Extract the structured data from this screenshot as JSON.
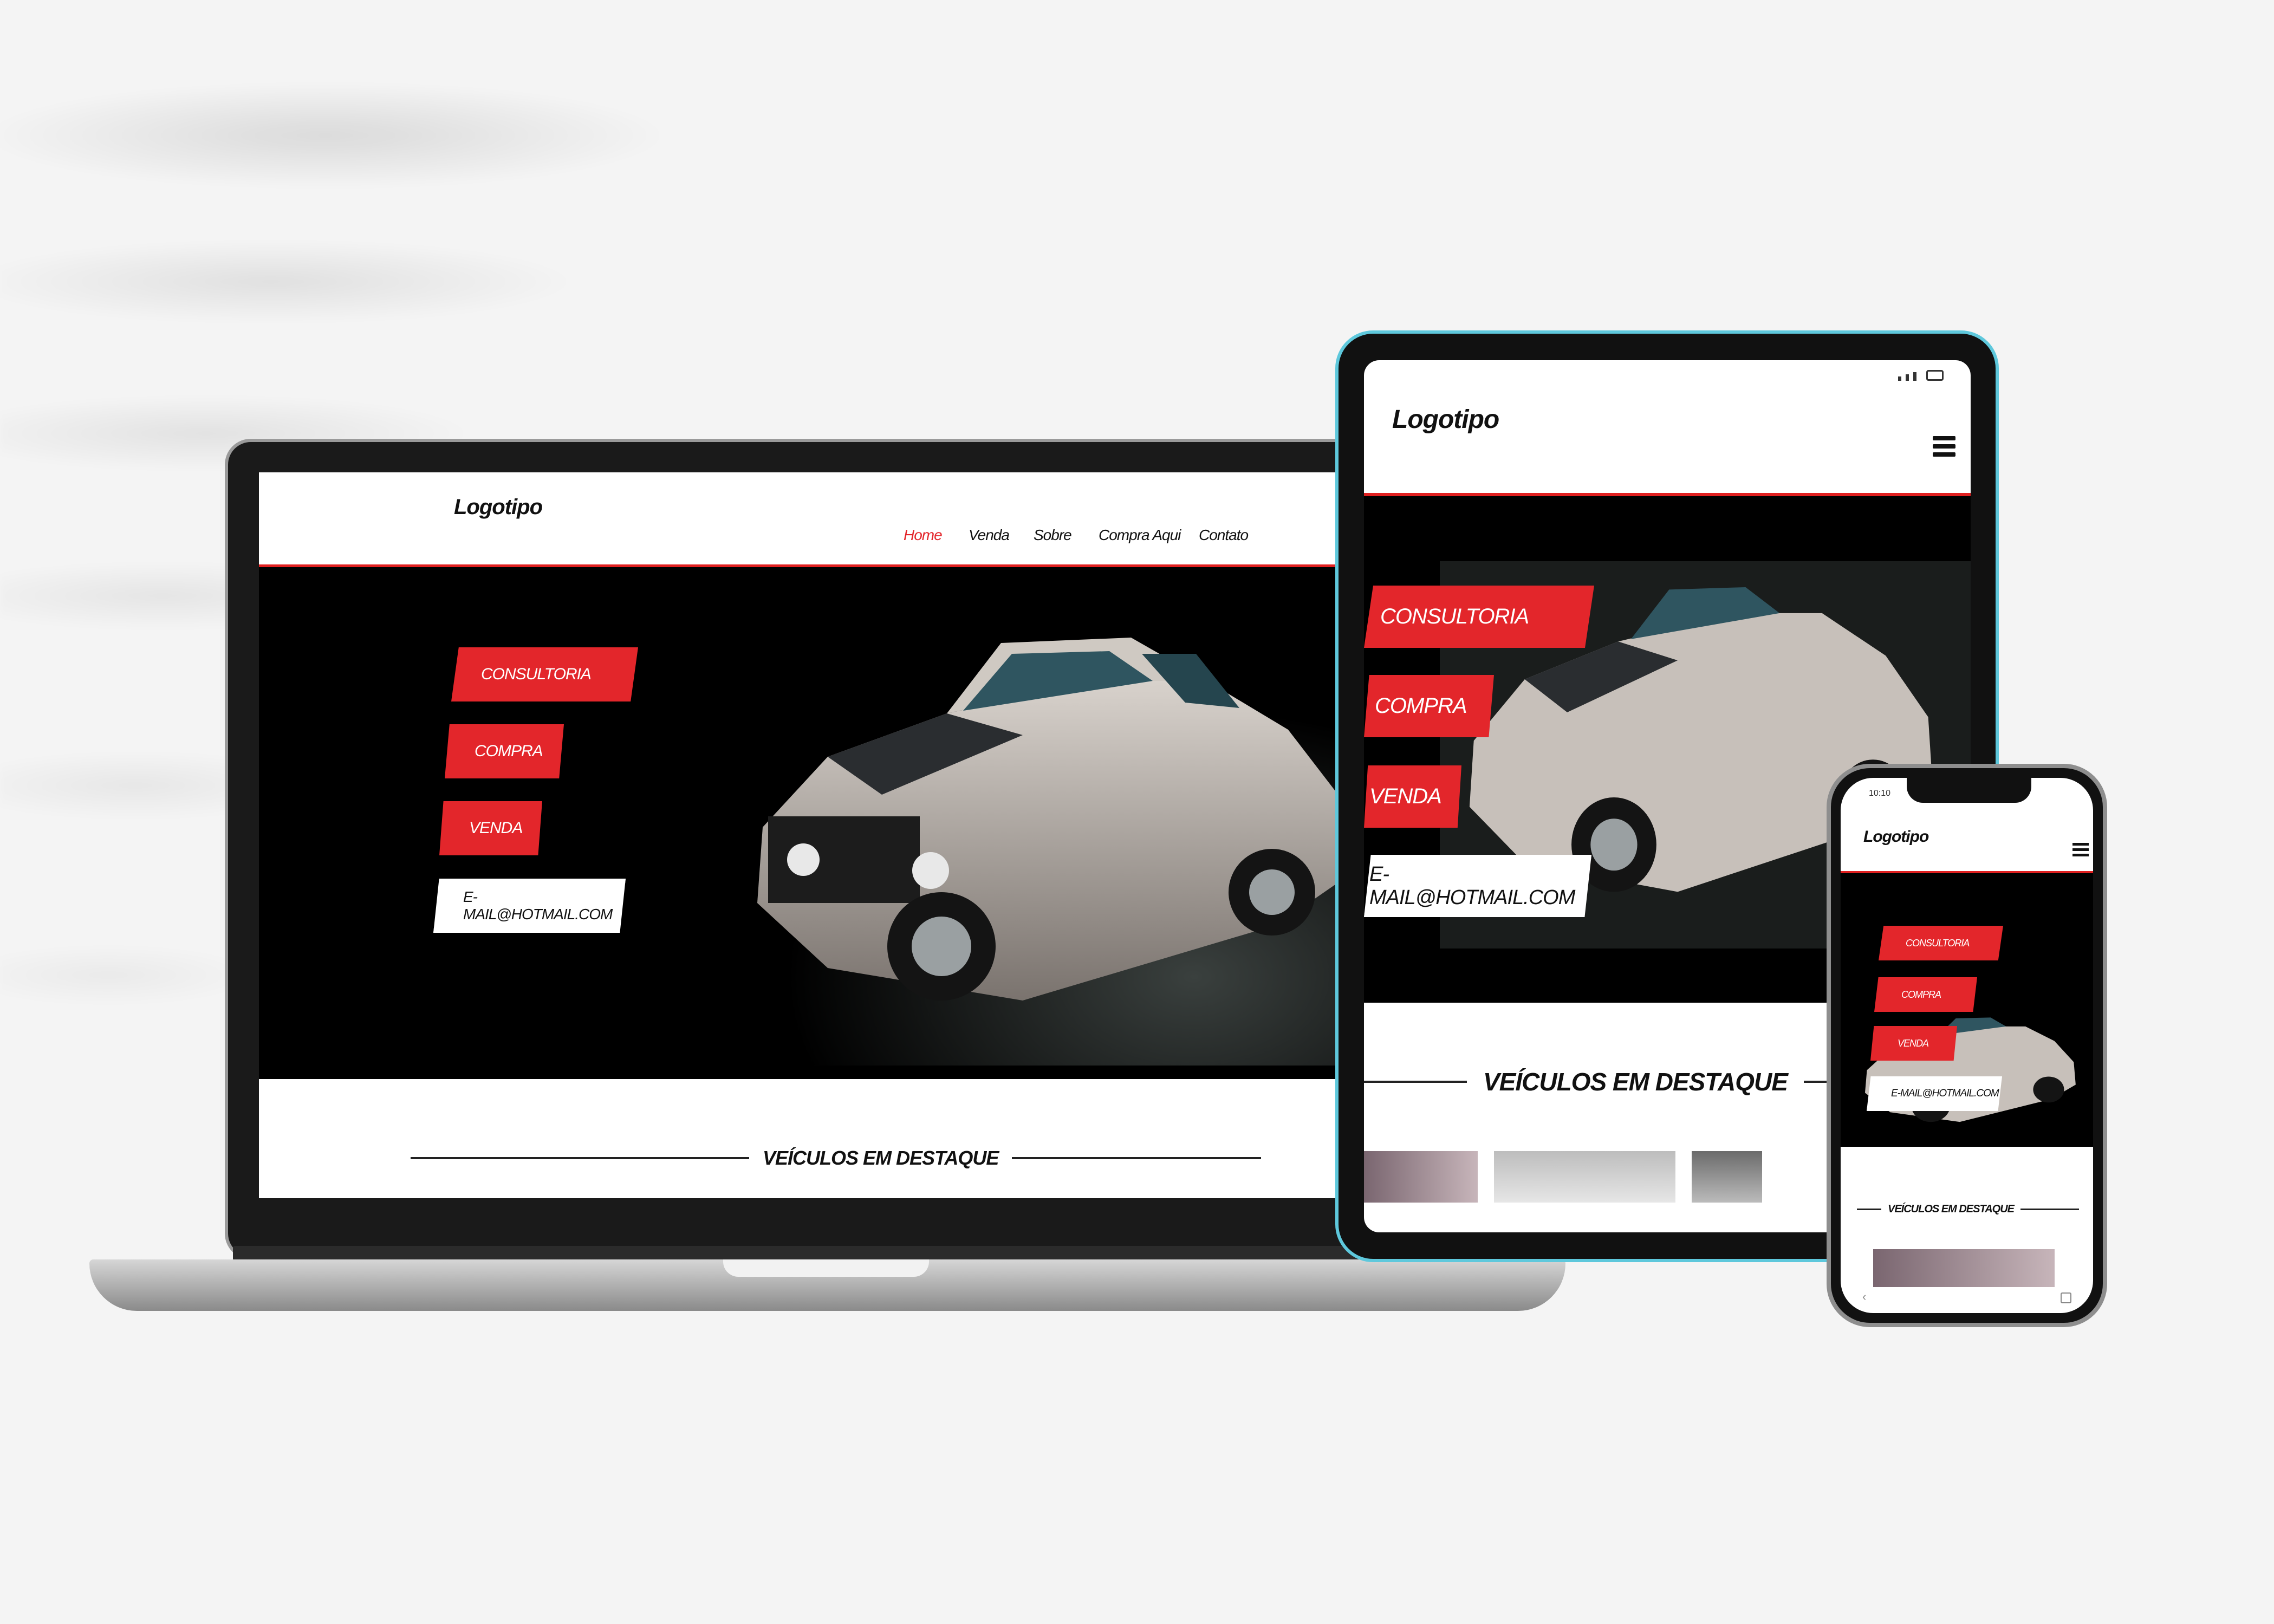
{
  "laptop": {
    "logo": "Logotipo",
    "nav": [
      {
        "label": "Home",
        "active": true
      },
      {
        "label": "Venda",
        "active": false
      },
      {
        "label": "Sobre",
        "active": false
      },
      {
        "label": "Compra Aqui",
        "active": false
      },
      {
        "label": "Contato",
        "active": false
      }
    ],
    "buttons": [
      "CONSULTORIA",
      "COMPRA",
      "VENDA"
    ],
    "email": "E-MAIL@HOTMAIL.COM",
    "section_title": "VEÍCULOS EM DESTAQUE"
  },
  "tablet": {
    "logo": "Logotipo",
    "menu_icon": "hamburger-icon",
    "buttons": [
      "CONSULTORIA",
      "COMPRA",
      "VENDA"
    ],
    "email": "E-MAIL@HOTMAIL.COM",
    "section_title": "VEÍCULOS EM DESTAQUE"
  },
  "phone": {
    "status_time": "10:10",
    "logo": "Logotipo",
    "menu_icon": "hamburger-icon",
    "buttons": [
      "CONSULTORIA",
      "COMPRA",
      "VENDA"
    ],
    "email": "E-MAIL@HOTMAIL.COM",
    "section_title": "VEÍCULOS EM DESTAQUE"
  },
  "colors": {
    "accent": "#e3262b",
    "hero_bg": "#000000",
    "header_bg": "#ffffff"
  }
}
